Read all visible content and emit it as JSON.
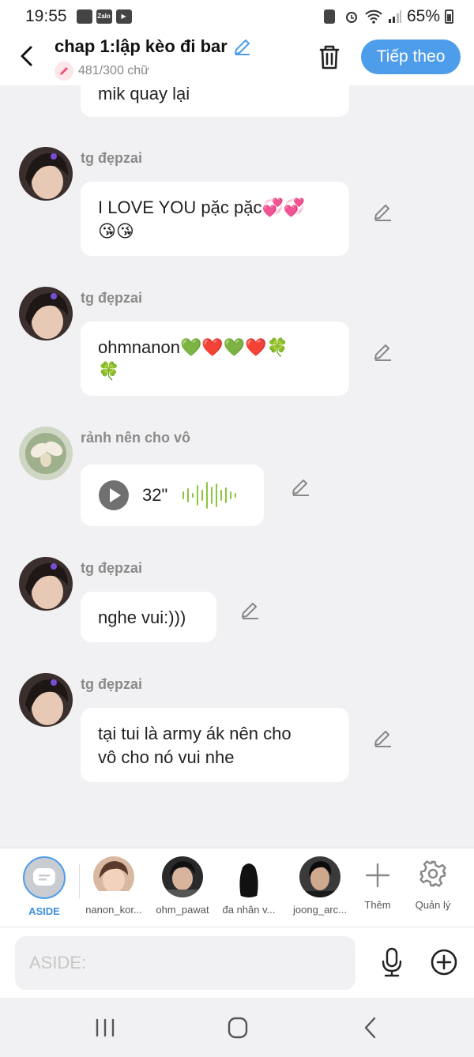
{
  "status_bar": {
    "time": "19:55",
    "app_icons": [
      "gallery-icon",
      "zalo-icon",
      "zalo-video-icon"
    ],
    "zalo_text": "Zalo",
    "battery": "65%"
  },
  "header": {
    "title": "chap 1:lập kèo đi bar",
    "word_count": "481/300 chữ",
    "next_label": "Tiếp theo"
  },
  "messages": [
    {
      "text": "mik quay lại"
    },
    {
      "sender": "tg đẹpzai",
      "text_line1": "I LOVE YOU pặc pặc💞💞",
      "text_line2": "😘😘"
    },
    {
      "sender": "tg đẹpzai",
      "text_line1": "ohmnanon💚❤️💚❤️🍀",
      "text_line2": "🍀"
    },
    {
      "sender": "rảnh nên cho vô",
      "audio_duration": "32\""
    },
    {
      "sender": "tg đẹpzai",
      "text": "nghe vui:)))"
    },
    {
      "sender": "tg đẹpzai",
      "text_line1": "tại tui là army ák nên cho",
      "text_line2": "vô cho nó vui nhe"
    }
  ],
  "characters": [
    {
      "label": "ASIDE",
      "selected": true
    },
    {
      "label": "nanon_kor..."
    },
    {
      "label": "ohm_pawat"
    },
    {
      "label": "đa nhân v..."
    },
    {
      "label": "joong_arc..."
    }
  ],
  "char_actions": {
    "add_label": "Thêm",
    "manage_label": "Quản lý"
  },
  "input": {
    "placeholder": "ASIDE:"
  },
  "colors": {
    "accent": "#4e9dea",
    "wave": "#8cc63f",
    "background": "#f1f1f3"
  }
}
